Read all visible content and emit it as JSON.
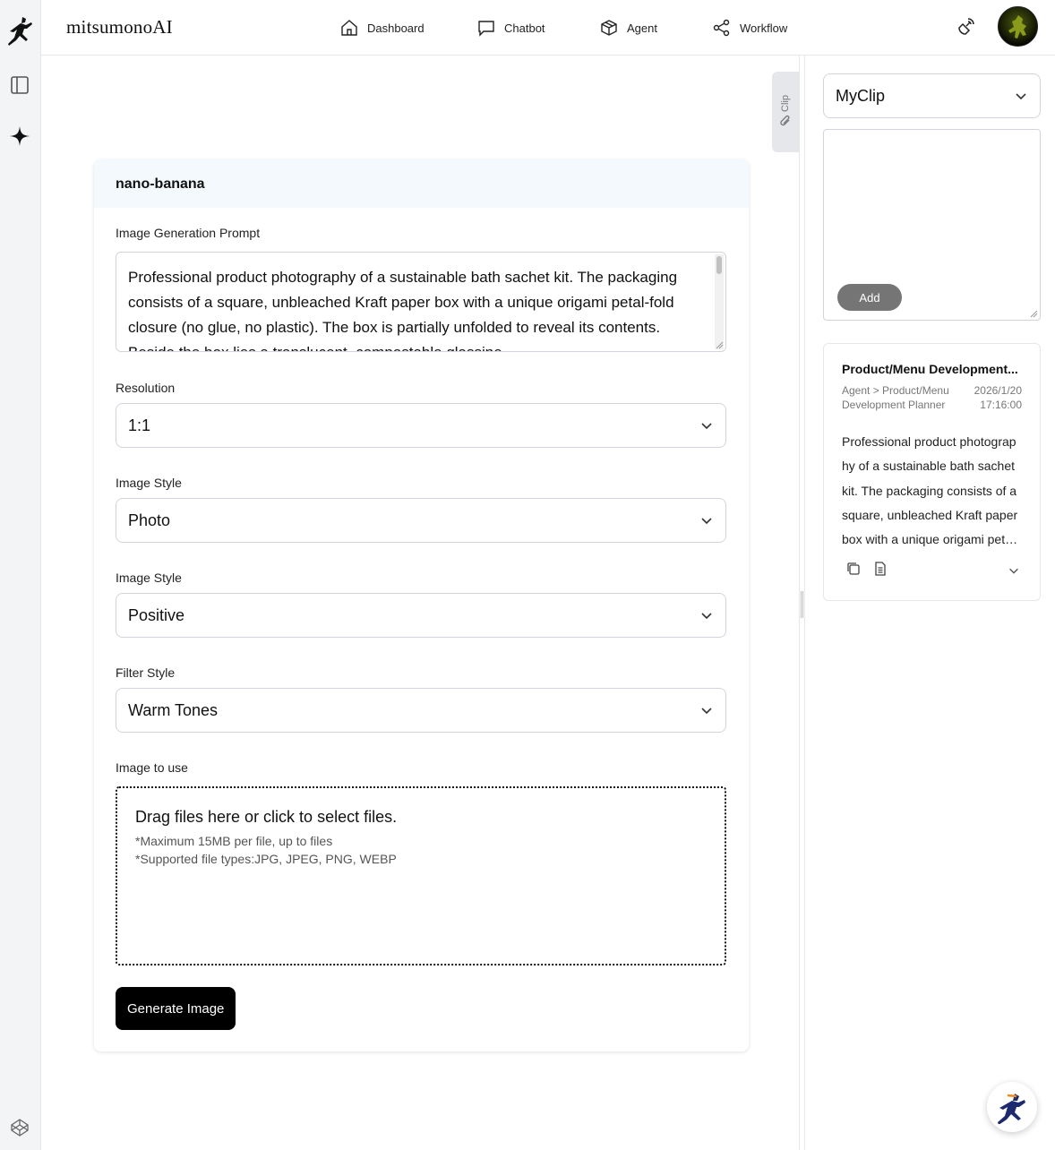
{
  "app": {
    "brand": "mitsumonoAI"
  },
  "nav": [
    {
      "label": "Dashboard",
      "icon": "home-icon"
    },
    {
      "label": "Chatbot",
      "icon": "chat-bubble-icon"
    },
    {
      "label": "Agent",
      "icon": "cube-icon"
    },
    {
      "label": "Workflow",
      "icon": "share-nodes-icon"
    }
  ],
  "clip_tab": {
    "label": "Clip"
  },
  "form": {
    "title": "nano-banana",
    "prompt_label": "Image Generation Prompt",
    "prompt_value": "Professional product photography of a sustainable bath sachet kit. The packaging consists of a square, unbleached Kraft paper box with a unique origami petal-fold closure (no glue, no plastic). The box is partially unfolded to reveal its contents. Beside the box lies a translucent, compostable glassine",
    "resolution_label": "Resolution",
    "resolution_value": "1:1",
    "style_label": "Image Style",
    "style_value": "Photo",
    "style2_label": "Image Style",
    "style2_value": "Positive",
    "filter_label": "Filter Style",
    "filter_value": "Warm Tones",
    "image_label": "Image to use",
    "dropzone_title": "Drag files here or click to select files.",
    "dropzone_note1": "*Maximum 15MB per file, up to files",
    "dropzone_note2": "*Supported file types:JPG, JPEG, PNG, WEBP",
    "generate_label": "Generate Image"
  },
  "sidebar": {
    "select_value": "MyClip",
    "add_label": "Add",
    "clip": {
      "title": "Product/Menu Development...",
      "path": "Agent > Product/Menu Development Planner",
      "date": "2026/1/20",
      "time": "17:16:00",
      "body": "Professional product photography of a sustainable bath sachet kit. The packaging consists of a square, unbleached Kraft paper box with a unique origami petal-fold closure"
    }
  },
  "colors": {
    "primary_button": "#000000",
    "add_button": "#757575",
    "card_header": "#f4f9fd"
  }
}
